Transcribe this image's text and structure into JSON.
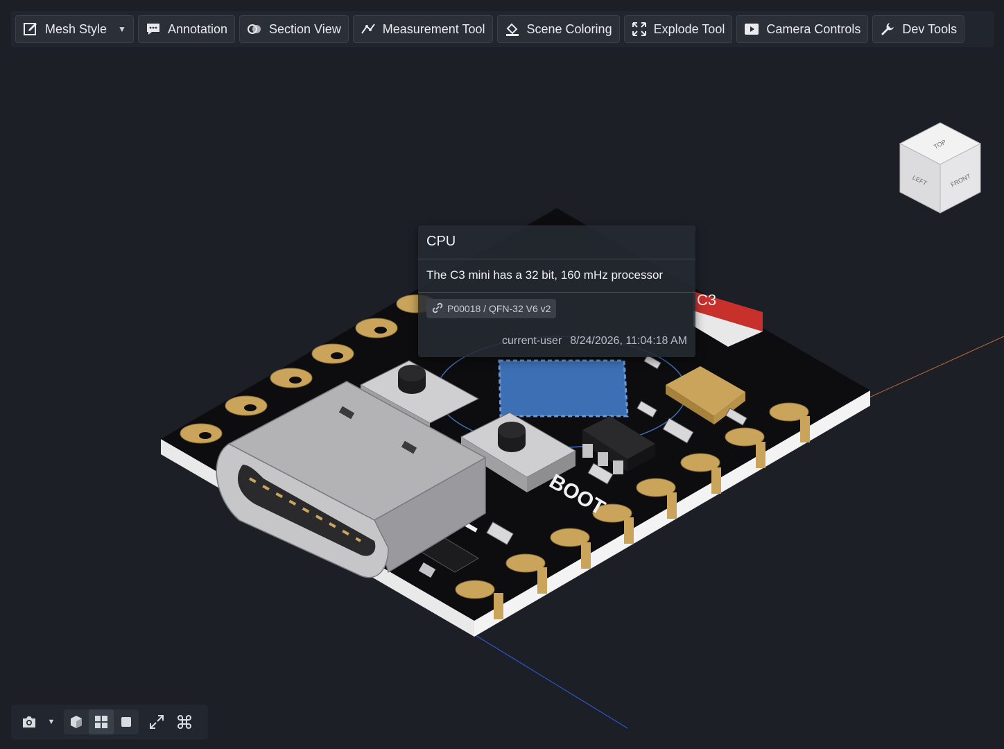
{
  "toolbar": {
    "buttons": [
      {
        "label": "Mesh Style",
        "icon": "edit-square-icon",
        "has_dropdown": true
      },
      {
        "label": "Annotation",
        "icon": "comment-icon"
      },
      {
        "label": "Section View",
        "icon": "section-view-icon"
      },
      {
        "label": "Measurement Tool",
        "icon": "measure-icon"
      },
      {
        "label": "Scene Coloring",
        "icon": "paint-bucket-icon"
      },
      {
        "label": "Explode Tool",
        "icon": "expand-arrows-icon"
      },
      {
        "label": "Camera Controls",
        "icon": "play-icon"
      },
      {
        "label": "Dev Tools",
        "icon": "wrench-icon"
      }
    ]
  },
  "navcube": {
    "top": "TOP",
    "left": "LEFT",
    "front": "FRONT"
  },
  "tooltip": {
    "title": "CPU",
    "description": "The C3 mini has a 32 bit, 160 mHz processor",
    "link_label": "P00018 / QFN-32 V6 v2",
    "user": "current-user",
    "timestamp": "8/24/2026, 11:04:18 AM"
  },
  "board": {
    "silkscreen_boot": "BOOT",
    "silkscreen_c3": "C3"
  },
  "bottom_toolbar": {
    "icons": [
      "camera-icon",
      "chevron-down-icon",
      "cube-view-icon",
      "grid-view-icon",
      "single-view-icon",
      "fullscreen-icon",
      "command-icon"
    ]
  },
  "colors": {
    "background": "#1c1f26",
    "board": "#0d0d0f",
    "pads": "#c9a45a",
    "highlight": "#3d6fb4"
  }
}
